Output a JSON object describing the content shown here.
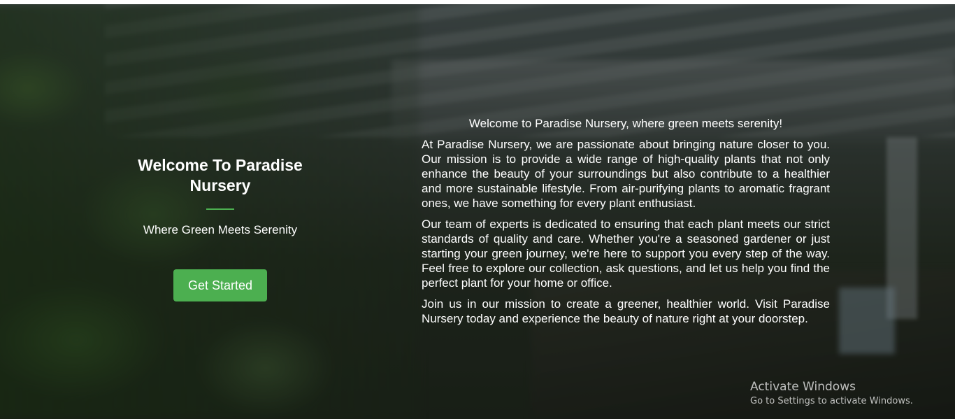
{
  "intro": {
    "title": "Welcome To Paradise Nursery",
    "tagline": "Where Green Meets Serenity",
    "button_label": "Get Started"
  },
  "about": {
    "heading": "Welcome to Paradise Nursery, where green meets serenity!",
    "paragraphs": [
      "At Paradise Nursery, we are passionate about bringing nature closer to you. Our mission is to provide a wide range of high-quality plants that not only enhance the beauty of your surroundings but also contribute to a healthier and more sustainable lifestyle. From air-purifying plants to aromatic fragrant ones, we have something for every plant enthusiast.",
      "Our team of experts is dedicated to ensuring that each plant meets our strict standards of quality and care. Whether you're a seasoned gardener or just starting your green journey, we're here to support you every step of the way. Feel free to explore our collection, ask questions, and let us help you find the perfect plant for your home or office.",
      "Join us in our mission to create a greener, healthier world. Visit Paradise Nursery today and experience the beauty of nature right at your doorstep."
    ]
  },
  "watermark": {
    "title": "Activate Windows",
    "subtitle": "Go to Settings to activate Windows."
  },
  "colors": {
    "accent": "#4caf50",
    "text": "#ffffff"
  }
}
